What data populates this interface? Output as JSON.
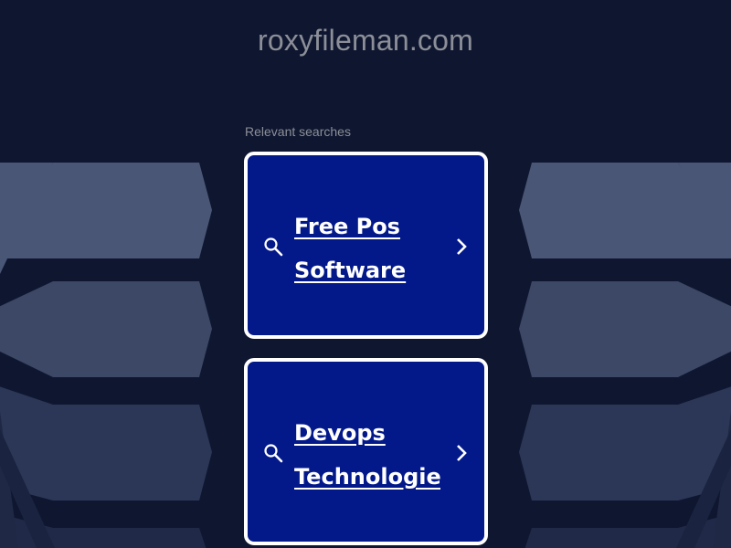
{
  "header": {
    "domain": "roxyfileman.com"
  },
  "searches": {
    "label": "Relevant searches",
    "items": [
      {
        "line1": "Free Pos",
        "line2": "Software",
        "icon": "search-icon",
        "arrow": "chevron-right-icon"
      },
      {
        "line1": "Devops",
        "line2": "Technologies",
        "icon": "search-icon",
        "arrow": "chevron-right-icon"
      }
    ]
  },
  "colors": {
    "background": "#0f1730",
    "card_fill": "#03198a",
    "card_border": "#ffffff",
    "muted_text": "#8c8f98"
  }
}
